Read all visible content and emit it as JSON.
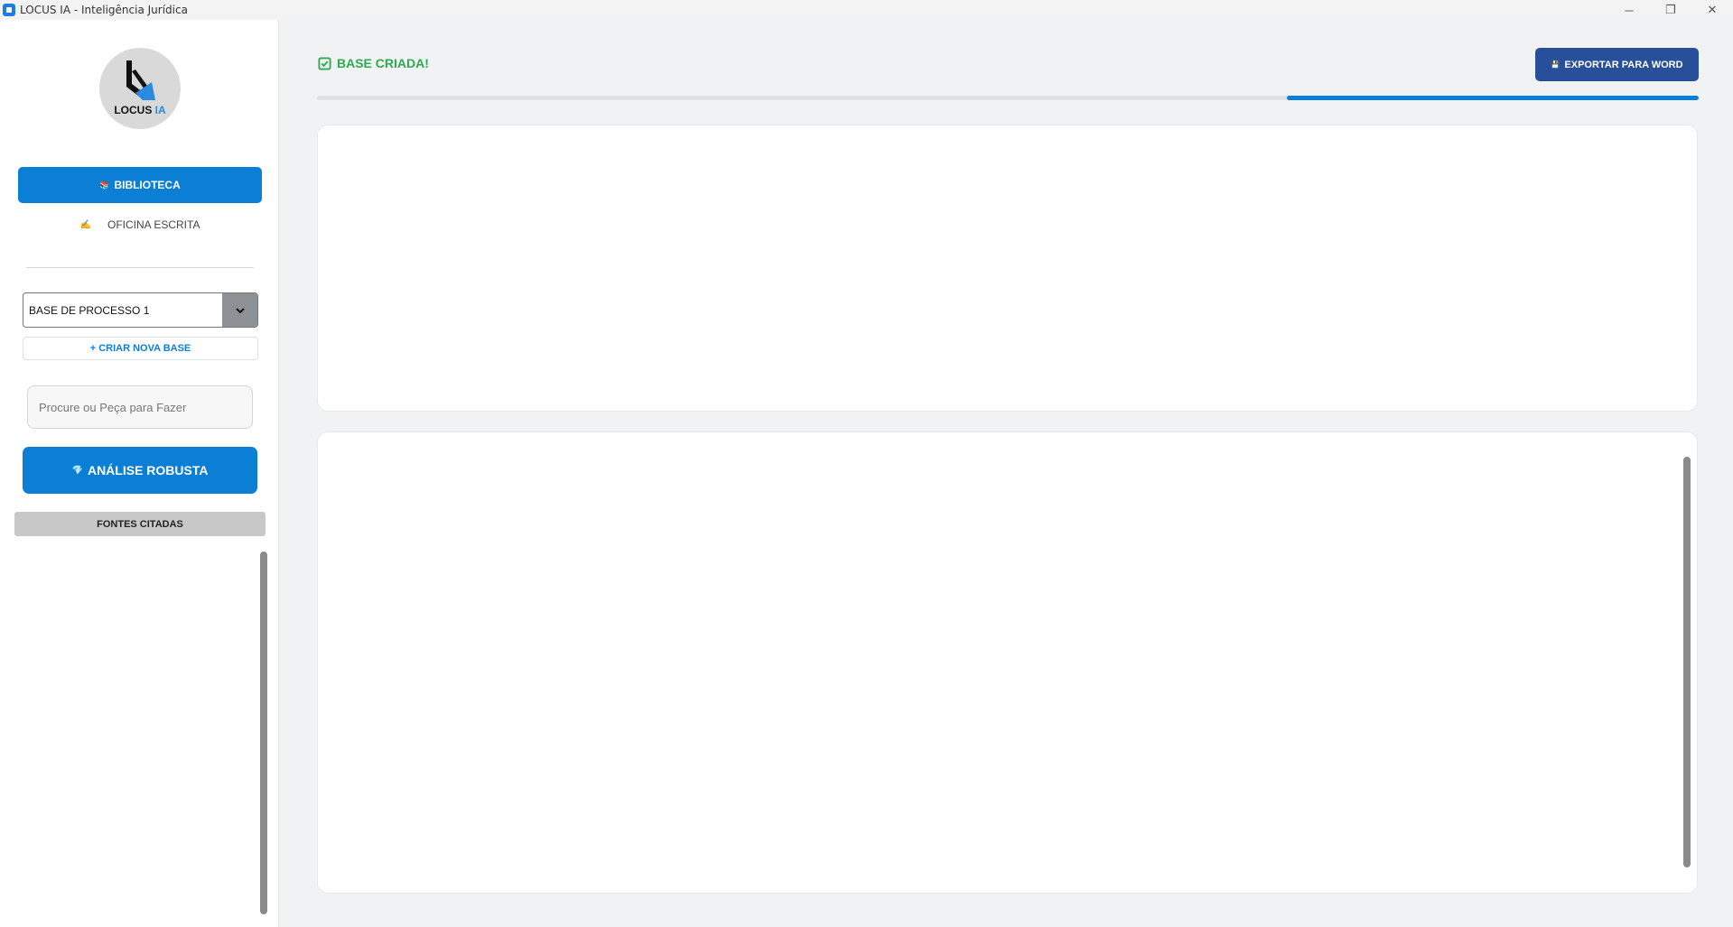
{
  "window": {
    "title": "LOCUS IA - Inteligência Jurídica",
    "minimize_glyph": "─",
    "restore_glyph": "❐",
    "close_glyph": "✕"
  },
  "sidebar": {
    "logo": {
      "text_main": "LOCUS",
      "text_accent": "IA"
    },
    "nav": {
      "biblioteca_label": "BIBLIOTECA",
      "biblioteca_icon": "📚",
      "oficina_label": "OFICINA ESCRITA",
      "oficina_icon": "✍"
    },
    "base_select": {
      "value": "BASE DE PROCESSO 1"
    },
    "create_base_label": "+ CRIAR NOVA BASE",
    "search": {
      "placeholder": "Procure ou Peça para Fazer",
      "value": ""
    },
    "analysis_button": {
      "label": "ANÁLISE ROBUSTA",
      "icon": "💎"
    },
    "sources_header": "FONTES CITADAS"
  },
  "main": {
    "status": {
      "text": "BASE CRIADA!",
      "color": "#2eaa4f"
    },
    "export_button": {
      "label": "EXPORTAR PARA WORD",
      "icon": "💾"
    },
    "progress": {
      "start": 0.702,
      "end": 1.0
    }
  },
  "colors": {
    "accent": "#0b7fd6",
    "export": "#284f9a",
    "success": "#2eaa4f"
  }
}
